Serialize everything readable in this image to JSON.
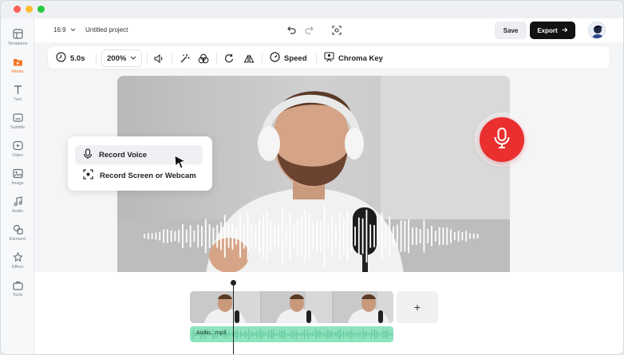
{
  "sidebar": {
    "items": [
      {
        "label": "Templates",
        "icon": "templates-icon"
      },
      {
        "label": "Media",
        "icon": "media-icon",
        "active": true
      },
      {
        "label": "Text",
        "icon": "text-icon"
      },
      {
        "label": "Subtitle",
        "icon": "subtitle-icon"
      },
      {
        "label": "Video",
        "icon": "video-icon"
      },
      {
        "label": "Image",
        "icon": "image-icon"
      },
      {
        "label": "Audio",
        "icon": "audio-icon"
      },
      {
        "label": "Element",
        "icon": "element-icon"
      },
      {
        "label": "Effect",
        "icon": "effect-icon"
      },
      {
        "label": "Tools",
        "icon": "tools-icon"
      }
    ]
  },
  "topbar": {
    "aspect_ratio": "16:9",
    "project_name": "Untitled project",
    "save_label": "Save",
    "export_label": "Export"
  },
  "toolbar": {
    "duration": "5.0s",
    "zoom": "200%",
    "speed_label": "Speed",
    "chroma_key_label": "Chroma Key"
  },
  "record_menu": {
    "items": [
      {
        "label": "Record Voice",
        "icon": "microphone-icon"
      },
      {
        "label": "Record Screen or Webcam",
        "icon": "screen-record-icon"
      }
    ]
  },
  "timeline": {
    "add_label": "+",
    "audio_label": "Audio...mp3"
  },
  "colors": {
    "accent": "#f07a28",
    "record": "#ea2f2f",
    "audio_track": "#8fe3be",
    "export_button": "#121212"
  }
}
